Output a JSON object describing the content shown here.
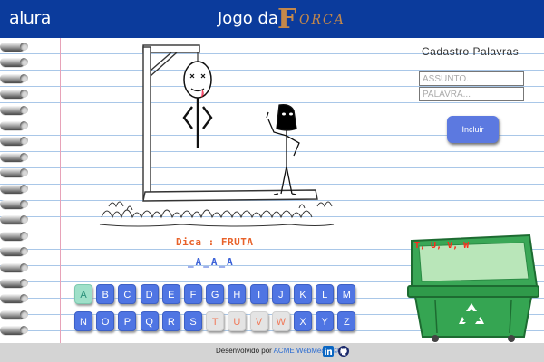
{
  "header": {
    "logo": "alura",
    "title": "Jogo da",
    "title_f": "F",
    "title_rest": "ORCA"
  },
  "form": {
    "title": "Cadastro Palavras",
    "assunto_placeholder": "ASSUNTO...",
    "palavra_placeholder": "PALAVRA...",
    "incluir_label": "Incluir"
  },
  "game": {
    "hint": "Dica : FRUTA",
    "word_display": "_A_A_A",
    "wrong_letters": "T, U, V, W"
  },
  "keyboard": {
    "row1": [
      "A",
      "B",
      "C",
      "D",
      "E",
      "F",
      "G",
      "H",
      "I",
      "J",
      "K",
      "L",
      "M"
    ],
    "row2": [
      "N",
      "O",
      "P",
      "Q",
      "R",
      "S",
      "T",
      "U",
      "V",
      "W",
      "X",
      "Y",
      "Z"
    ],
    "correct": [
      "A"
    ],
    "wrong": [
      "T",
      "U",
      "V",
      "W"
    ]
  },
  "footer": {
    "text": "Desenvolvido por",
    "link": "ACME WebMedia ©"
  },
  "colors": {
    "header": "#0b3b9c",
    "key": "#4f75e3",
    "trash": "#2f9a4a",
    "hint": "#e8622a",
    "wrong": "#ff2a1a"
  },
  "icons": {
    "linkedin": "linkedin-icon",
    "github": "github-icon",
    "recycle": "recycle-icon"
  }
}
